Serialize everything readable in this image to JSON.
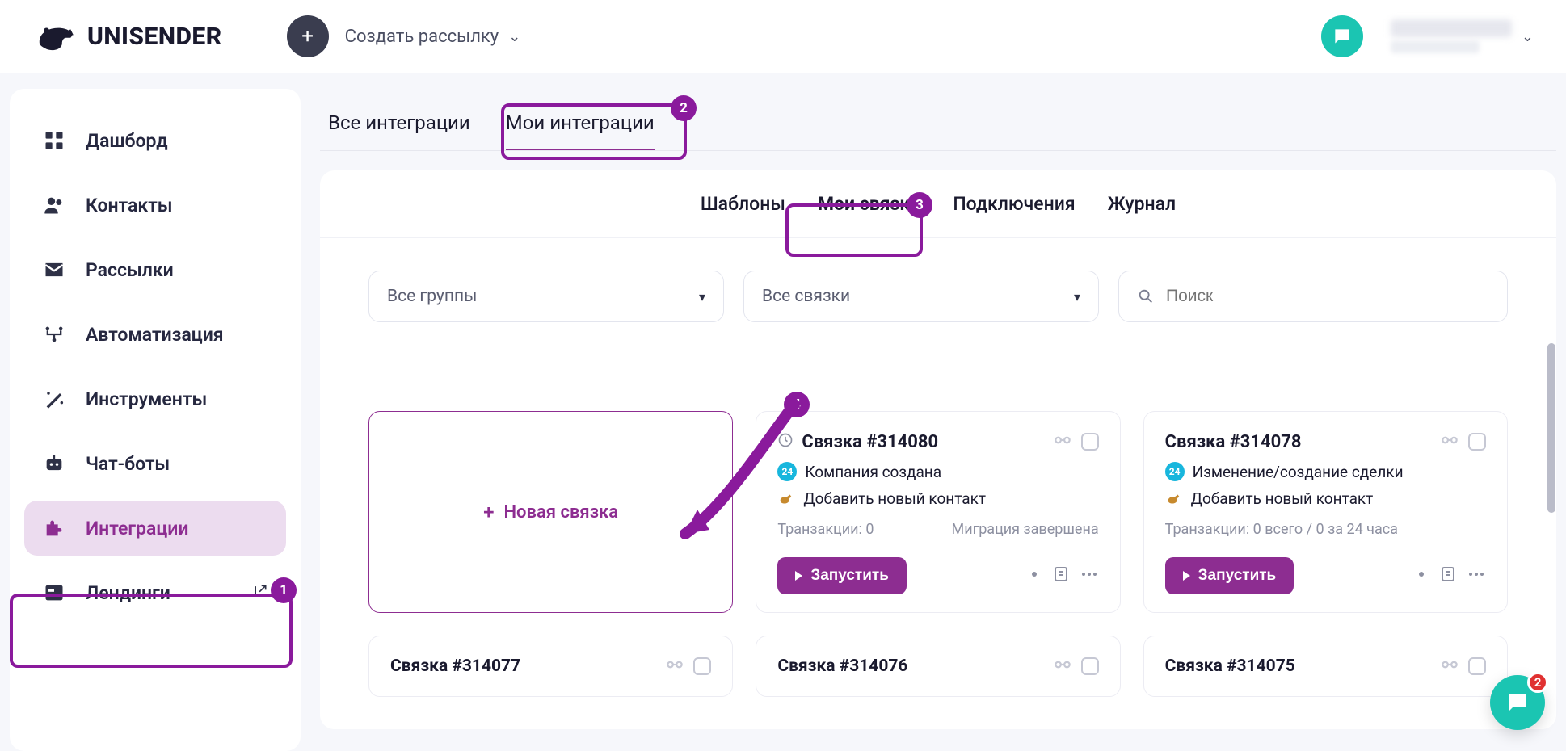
{
  "brand": {
    "name": "UNISENDER"
  },
  "topbar": {
    "create_label": "Создать рассылку"
  },
  "sidebar": {
    "items": [
      {
        "label": "Дашборд"
      },
      {
        "label": "Контакты"
      },
      {
        "label": "Рассылки"
      },
      {
        "label": "Автоматизация"
      },
      {
        "label": "Инструменты"
      },
      {
        "label": "Чат-боты"
      },
      {
        "label": "Интеграции"
      },
      {
        "label": "Лендинги"
      }
    ]
  },
  "tabs_top": {
    "all": "Все интеграции",
    "mine": "Мои интеграции"
  },
  "subtabs": {
    "templates": "Шаблоны",
    "links": "Мои связки",
    "connections": "Подключения",
    "log": "Журнал"
  },
  "filters": {
    "groups": "Все группы",
    "links": "Все связки",
    "search_placeholder": "Поиск"
  },
  "new_link_label": "Новая связка",
  "cards": [
    {
      "title": "Связка #314080",
      "has_clock": true,
      "event": "Компания создана",
      "action": "Добавить новый контакт",
      "meta_left": "Транзакции: 0",
      "meta_right": "Миграция завершена",
      "run_label": "Запустить"
    },
    {
      "title": "Связка #314078",
      "has_clock": false,
      "event": "Изменение/создание сделки",
      "action": "Добавить новый контакт",
      "meta_left": "Транзакции: 0 всего / 0 за 24 часа",
      "meta_right": "",
      "run_label": "Запустить"
    }
  ],
  "stubs": [
    {
      "title": "Связка #314077"
    },
    {
      "title": "Связка #314076"
    },
    {
      "title": "Связка #314075"
    }
  ],
  "annotations": {
    "n1": "1",
    "n2": "2",
    "n3": "3",
    "n4": "4"
  },
  "chat_notif": "2"
}
